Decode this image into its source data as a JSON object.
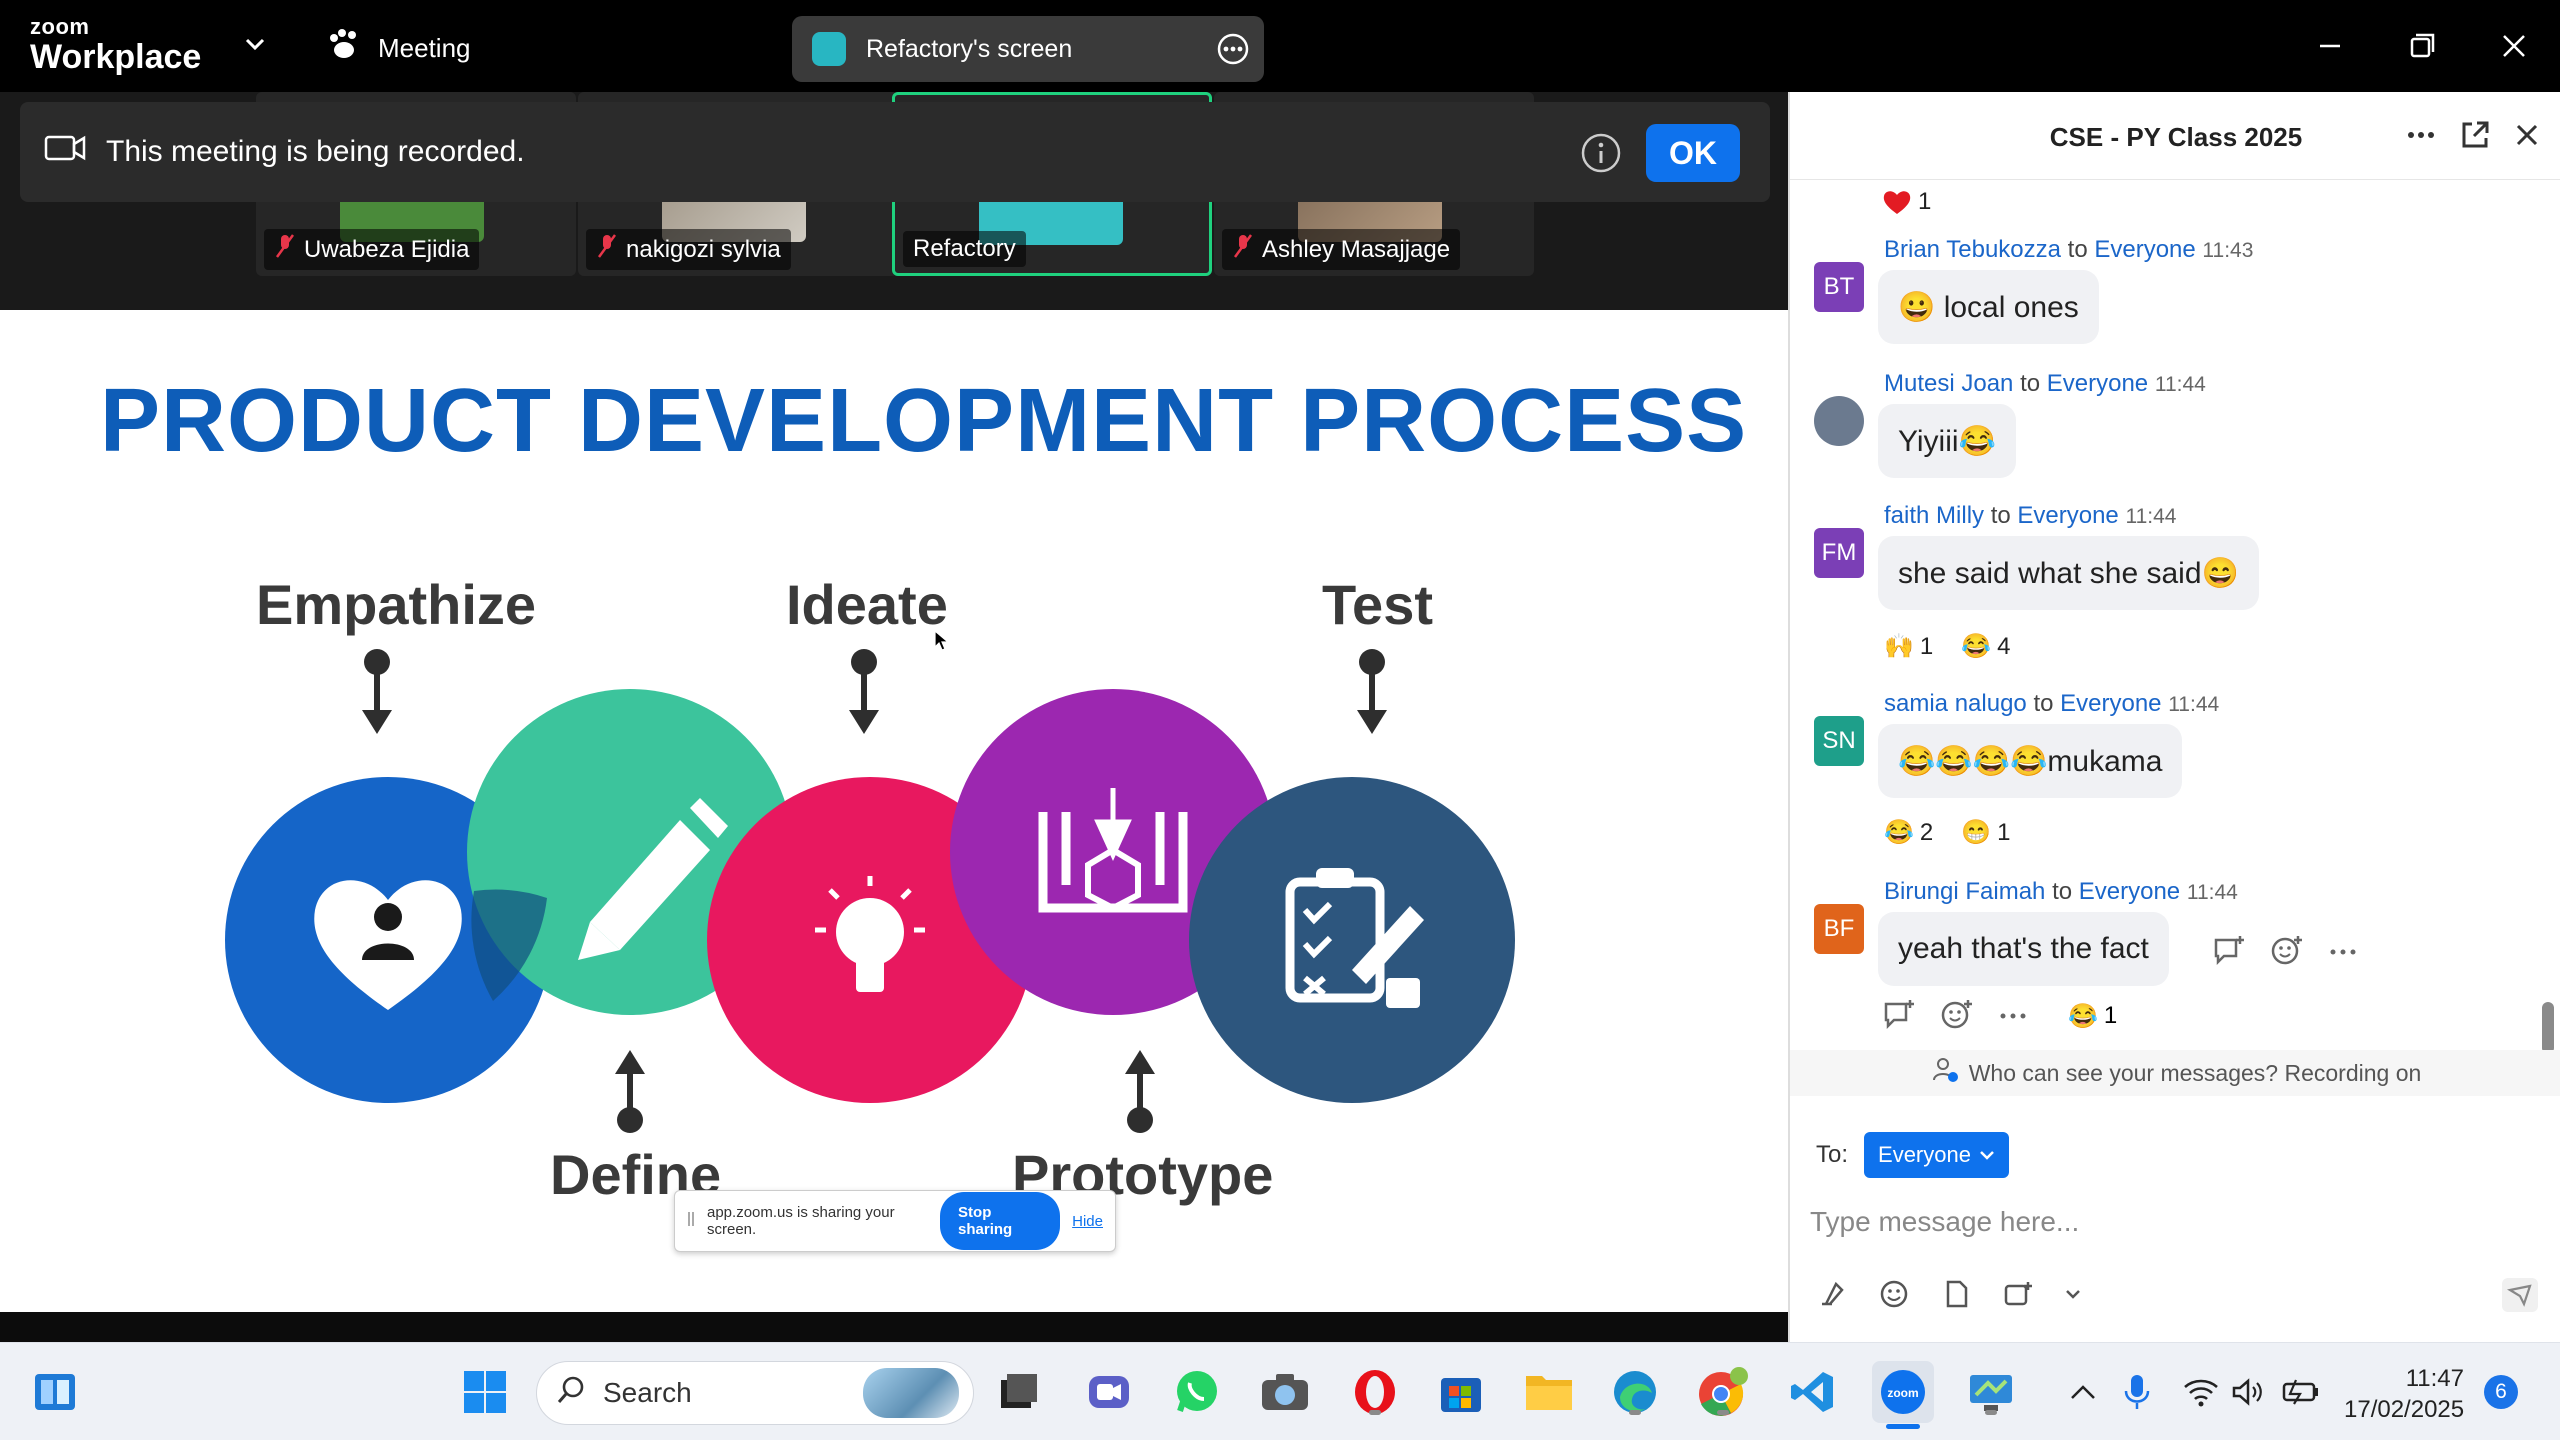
{
  "topbar": {
    "brand_line1": "zoom",
    "brand_line2": "Workplace",
    "meeting_label": "Meeting",
    "share_label": "Refactory's screen",
    "icons": [
      "chevron-down-icon",
      "paw-icon",
      "more-icon",
      "minimize-icon",
      "restore-icon",
      "close-icon"
    ]
  },
  "participants": [
    {
      "name": "Uwabeza Ejidia",
      "muted": true
    },
    {
      "name": "nakigozi sylvia",
      "muted": true
    },
    {
      "name": "Refactory",
      "muted": false,
      "active": true
    },
    {
      "name": "Ashley Masajjage",
      "muted": true
    }
  ],
  "recording_banner": {
    "text": "This meeting is being recorded.",
    "ok_label": "OK"
  },
  "slide": {
    "title": "PRODUCT DEVELOPMENT PROCESS",
    "stages_top": [
      "Empathize",
      "Ideate",
      "Test"
    ],
    "stages_bottom": [
      "Define",
      "Prototype"
    ],
    "colors": {
      "empathize": "#1565c8",
      "define": "#3cc49c",
      "ideate": "#e8185f",
      "prototype": "#9c27b0",
      "test": "#2d567e"
    }
  },
  "share_toast": {
    "text": "app.zoom.us is sharing your screen.",
    "stop_label": "Stop sharing",
    "hide_label": "Hide"
  },
  "chat": {
    "title": "CSE - PY Class 2025",
    "first_reaction": "1",
    "messages": [
      {
        "initials": "BT",
        "name": "Brian Tebukozza",
        "to": "to",
        "target": "Everyone",
        "time": "11:43",
        "text": "😀 local ones",
        "color": "#7b3fb6"
      },
      {
        "initials": "",
        "name": "Mutesi Joan",
        "to": "to",
        "target": "Everyone",
        "time": "11:44",
        "text": "Yiyiii😂",
        "color": "#6b7a8f"
      },
      {
        "initials": "FM",
        "name": "faith Milly",
        "to": "to",
        "target": "Everyone",
        "time": "11:44",
        "text": "she said what she said😄",
        "color": "#7b3fb6",
        "reactions": [
          {
            "emoji": "🙌",
            "count": "1"
          },
          {
            "emoji": "😂",
            "count": "4"
          }
        ]
      },
      {
        "initials": "SN",
        "name": "samia nalugo",
        "to": "to",
        "target": "Everyone",
        "time": "11:44",
        "text": "😂😂😂😂mukama",
        "color": "#1e9f8a",
        "reactions": [
          {
            "emoji": "😂",
            "count": "2"
          },
          {
            "emoji": "😁",
            "count": "1"
          }
        ]
      },
      {
        "initials": "BF",
        "name": "Birungi Faimah",
        "to": "to",
        "target": "Everyone",
        "time": "11:44",
        "text": "yeah that's the fact",
        "color": "#e0641b",
        "reactions": [
          {
            "emoji": "😂",
            "count": "1"
          }
        ]
      }
    ],
    "privacy_text": "Who can see your messages? Recording on",
    "to_label": "To:",
    "to_value": "Everyone",
    "input_placeholder": "Type message here..."
  },
  "taskbar": {
    "search_label": "Search",
    "time": "11:47",
    "date": "17/02/2025",
    "notification_count": "6"
  }
}
